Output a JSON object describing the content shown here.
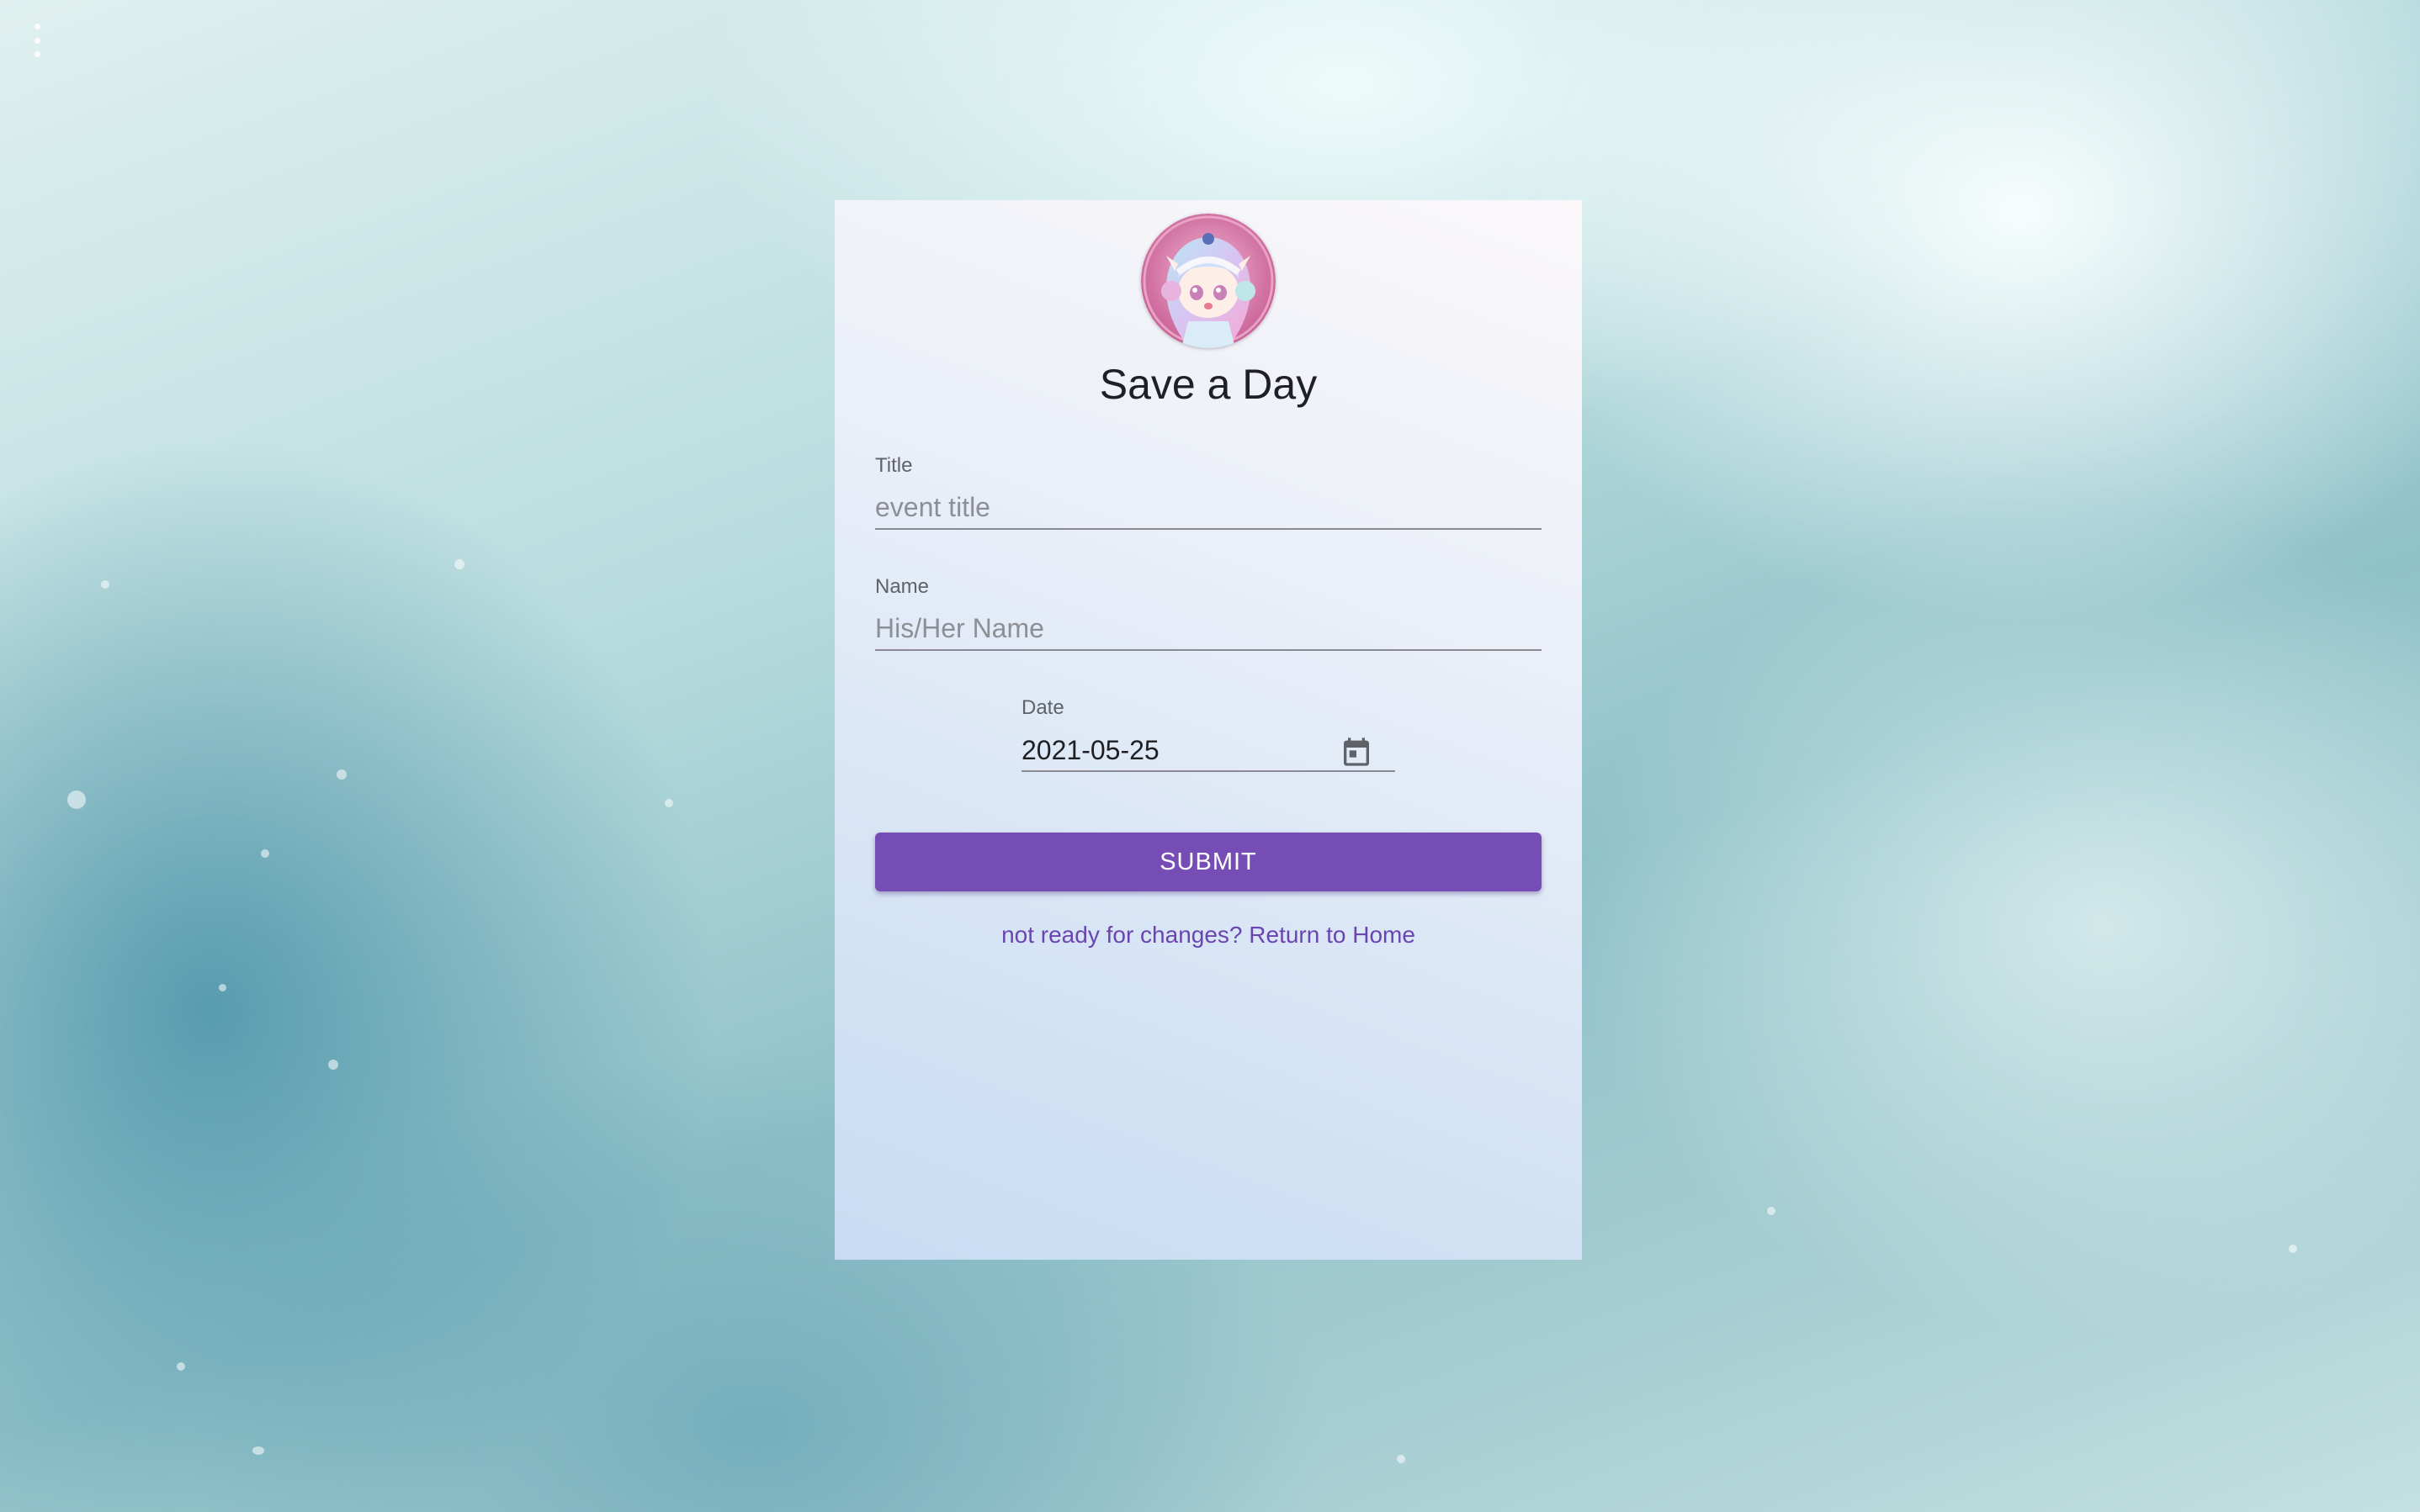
{
  "page": {
    "title": "Save a Day"
  },
  "toolbar": {
    "menu_icon": "vertical-dots-icon"
  },
  "avatar": {
    "description": "anime-style girl avatar with headphones"
  },
  "form": {
    "title_field": {
      "label": "Title",
      "placeholder": "event title",
      "value": ""
    },
    "name_field": {
      "label": "Name",
      "placeholder": "His/Her Name",
      "value": ""
    },
    "date_field": {
      "label": "Date",
      "value": "2021-05-25",
      "icon": "calendar-icon"
    },
    "submit_label": "SUBMIT",
    "return_link": "not ready for changes? Return to Home"
  },
  "colors": {
    "accent": "#764db4",
    "link": "#6a45b0",
    "text": "#1f1f24"
  }
}
